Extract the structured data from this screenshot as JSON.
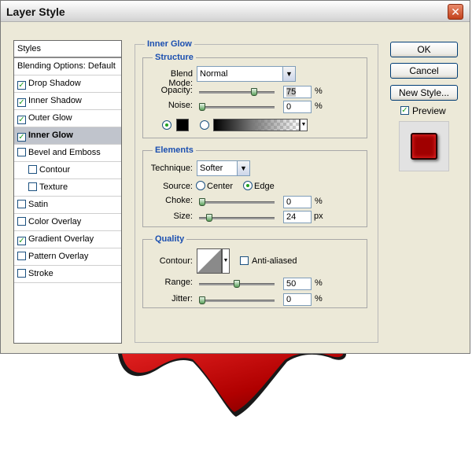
{
  "dialog": {
    "title": "Layer Style",
    "close_glyph": "✕"
  },
  "styles_list": {
    "items": [
      {
        "label": "Styles",
        "checkbox": false,
        "checked": false,
        "selected": false,
        "indent": 0
      },
      {
        "label": "Blending Options: Default",
        "checkbox": false,
        "checked": false,
        "selected": false,
        "indent": 0
      },
      {
        "label": "Drop Shadow",
        "checkbox": true,
        "checked": true,
        "selected": false,
        "indent": 0
      },
      {
        "label": "Inner Shadow",
        "checkbox": true,
        "checked": true,
        "selected": false,
        "indent": 0
      },
      {
        "label": "Outer Glow",
        "checkbox": true,
        "checked": true,
        "selected": false,
        "indent": 0
      },
      {
        "label": "Inner Glow",
        "checkbox": true,
        "checked": true,
        "selected": true,
        "indent": 0
      },
      {
        "label": "Bevel and Emboss",
        "checkbox": true,
        "checked": false,
        "selected": false,
        "indent": 0
      },
      {
        "label": "Contour",
        "checkbox": true,
        "checked": false,
        "selected": false,
        "indent": 1
      },
      {
        "label": "Texture",
        "checkbox": true,
        "checked": false,
        "selected": false,
        "indent": 1
      },
      {
        "label": "Satin",
        "checkbox": true,
        "checked": false,
        "selected": false,
        "indent": 0
      },
      {
        "label": "Color Overlay",
        "checkbox": true,
        "checked": false,
        "selected": false,
        "indent": 0
      },
      {
        "label": "Gradient Overlay",
        "checkbox": true,
        "checked": true,
        "selected": false,
        "indent": 0
      },
      {
        "label": "Pattern Overlay",
        "checkbox": true,
        "checked": false,
        "selected": false,
        "indent": 0
      },
      {
        "label": "Stroke",
        "checkbox": true,
        "checked": false,
        "selected": false,
        "indent": 0
      }
    ]
  },
  "inner_glow": {
    "section_title": "Inner Glow",
    "structure": {
      "title": "Structure",
      "blend_mode_label": "Blend Mode:",
      "blend_mode_value": "Normal",
      "opacity_label": "Opacity:",
      "opacity_value": "75",
      "opacity_fraction": 0.75,
      "noise_label": "Noise:",
      "noise_value": "0",
      "noise_fraction": 0.0,
      "percent": "%",
      "color_swatch": "#000000"
    },
    "elements": {
      "title": "Elements",
      "technique_label": "Technique:",
      "technique_value": "Softer",
      "source_label": "Source:",
      "source_center": "Center",
      "source_edge": "Edge",
      "choke_label": "Choke:",
      "choke_value": "0",
      "choke_fraction": 0.0,
      "size_label": "Size:",
      "size_value": "24",
      "size_fraction": 0.1,
      "percent": "%",
      "px": "px"
    },
    "quality": {
      "title": "Quality",
      "contour_label": "Contour:",
      "anti_aliased_label": "Anti-aliased",
      "range_label": "Range:",
      "range_value": "50",
      "range_fraction": 0.5,
      "jitter_label": "Jitter:",
      "jitter_value": "0",
      "jitter_fraction": 0.0,
      "percent": "%"
    }
  },
  "buttons": {
    "ok": "OK",
    "cancel": "Cancel",
    "new_style": "New Style...",
    "preview_label": "Preview"
  },
  "colors": {
    "accent_blue": "#1b4fb0",
    "preview_red": "#a00000"
  },
  "icons": {
    "dropdown": "chevron-down-icon",
    "close": "close-icon",
    "checkmark": "checkmark-icon"
  }
}
